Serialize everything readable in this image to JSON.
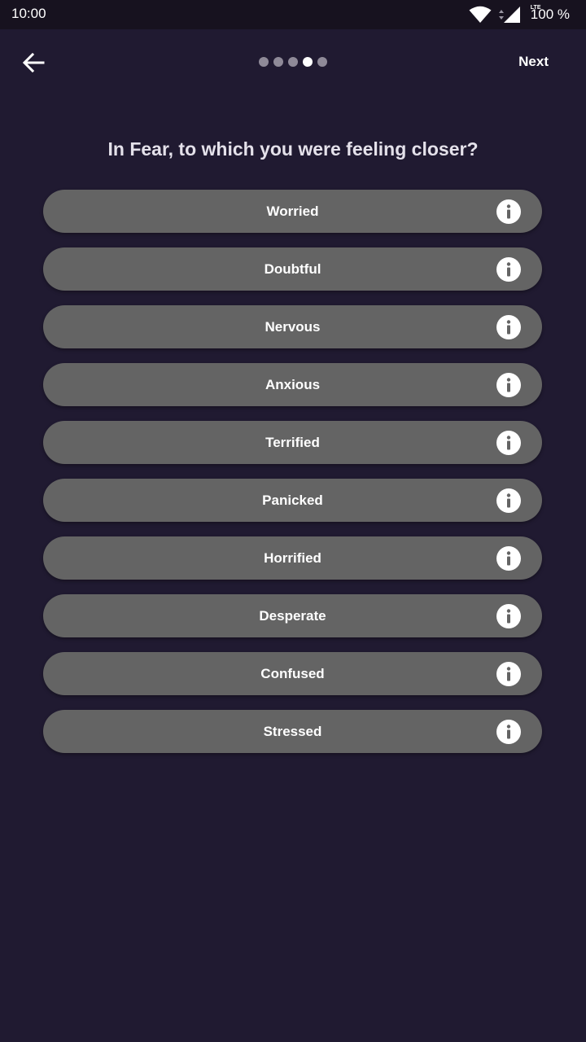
{
  "status_bar": {
    "time": "10:00",
    "network": "LTE",
    "battery": "100 %"
  },
  "header": {
    "back_icon": "arrow-left-icon",
    "progress": {
      "total_steps": 5,
      "current_step": 4
    },
    "next_label": "Next"
  },
  "question": "In Fear, to which you were feeling closer?",
  "options": [
    {
      "label": "Worried",
      "icon": "info-icon"
    },
    {
      "label": "Doubtful",
      "icon": "info-icon"
    },
    {
      "label": "Nervous",
      "icon": "info-icon"
    },
    {
      "label": "Anxious",
      "icon": "info-icon"
    },
    {
      "label": "Terrified",
      "icon": "info-icon"
    },
    {
      "label": "Panicked",
      "icon": "info-icon"
    },
    {
      "label": "Horrified",
      "icon": "info-icon"
    },
    {
      "label": "Desperate",
      "icon": "info-icon"
    },
    {
      "label": "Confused",
      "icon": "info-icon"
    },
    {
      "label": "Stressed",
      "icon": "info-icon"
    }
  ],
  "colors": {
    "background": "#201a31",
    "status_bar": "#17121f",
    "option_background": "#646464",
    "dot_inactive": "#8f8a98",
    "dot_active": "#ffffff"
  }
}
